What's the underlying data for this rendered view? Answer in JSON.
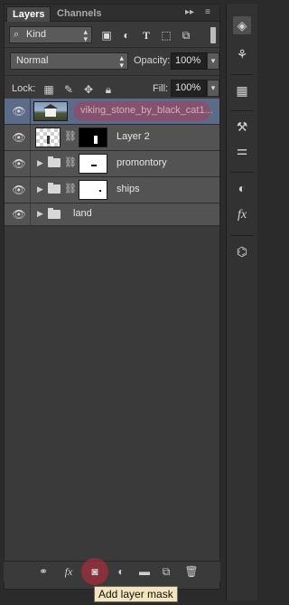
{
  "tabs": {
    "layers": "Layers",
    "channels": "Channels"
  },
  "filter": {
    "kind_label": "Kind",
    "kind_icon": "search-icon"
  },
  "blend": {
    "mode": "Normal"
  },
  "opacity": {
    "label": "Opacity:",
    "value": "100%"
  },
  "lock": {
    "label": "Lock:"
  },
  "fill": {
    "label": "Fill:",
    "value": "100%"
  },
  "layers": [
    {
      "name": "viking_stone_by_black_cat1...",
      "selected": true
    },
    {
      "name": "Layer 2"
    },
    {
      "name": "promontory"
    },
    {
      "name": "ships"
    },
    {
      "name": "land"
    }
  ],
  "tooltip": {
    "text": "Add layer mask"
  },
  "colors": {
    "accent_highlight": "#c8283c",
    "selected_layer": "#5b6b8a",
    "tooltip_bg": "#f5e5bf"
  }
}
